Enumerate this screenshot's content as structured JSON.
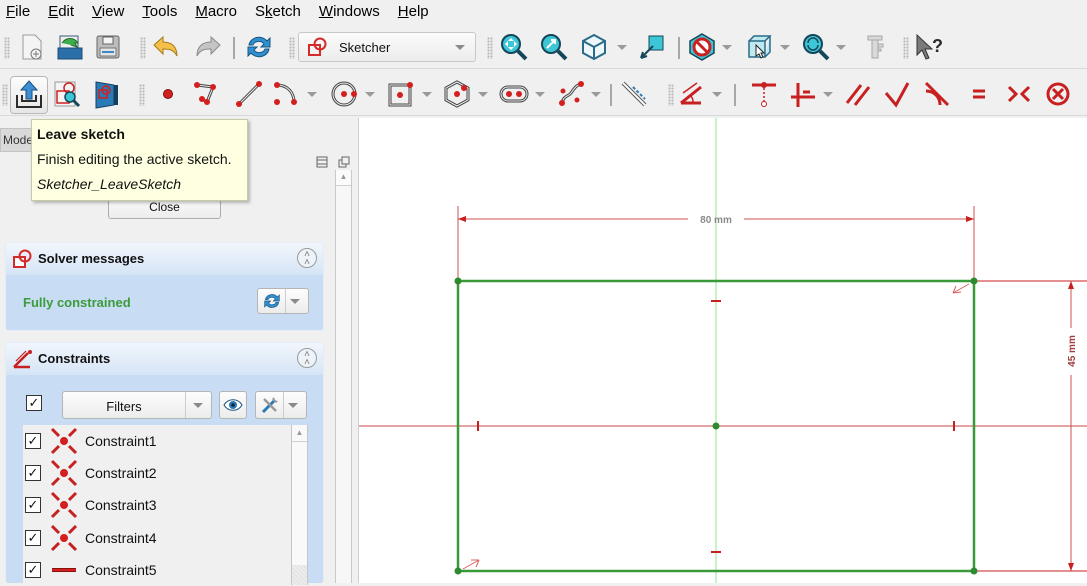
{
  "menu": [
    {
      "label": "File",
      "accel": "F"
    },
    {
      "label": "Edit",
      "accel": "E"
    },
    {
      "label": "View",
      "accel": "V"
    },
    {
      "label": "Tools",
      "accel": "T"
    },
    {
      "label": "Macro",
      "accel": "M"
    },
    {
      "label": "Sketch",
      "accel": "k"
    },
    {
      "label": "Windows",
      "accel": "W"
    },
    {
      "label": "Help",
      "accel": "H"
    }
  ],
  "toolbar": {
    "workbench_selector": {
      "selected": "Sketcher",
      "icon": "sketcher-workbench-icon"
    },
    "file_icons": [
      "new-document-icon",
      "open-document-icon",
      "save-icon"
    ],
    "edit_icons": [
      "undo-icon",
      "redo-icon",
      "refresh-icon"
    ],
    "view_icons": [
      "fit-all-icon",
      "fit-selection-icon",
      "isometric-view-icon",
      "view-section-icon",
      "draw-style-icon",
      "bounding-box-icon",
      "zoom-refresh-icon",
      "measure-icon",
      "whats-this-icon"
    ]
  },
  "sketcher_toolbar": {
    "leave_sketch": "leave-sketch-icon",
    "view_sketch": "view-sketch-icon",
    "view_section": "view-section-icon",
    "geometry": [
      "point-icon",
      "polyline-icon",
      "line-icon",
      "arc-icon",
      "circle-icon",
      "rectangle-icon",
      "polygon-icon",
      "slot-icon",
      "bspline-icon",
      "construction-mode-icon"
    ],
    "constraints": [
      "dimension-icon",
      "coincident-icon",
      "horizontal-vertical-icon",
      "parallel-icon",
      "perpendicular-icon",
      "tangent-icon",
      "equal-icon",
      "symmetric-icon",
      "block-icon"
    ]
  },
  "tooltip": {
    "title": "Leave sketch",
    "description": "Finish editing the active sketch.",
    "command": "Sketcher_LeaveSketch"
  },
  "panel": {
    "mode_tab": "Model",
    "close_label": "Close",
    "solver": {
      "title": "Solver messages",
      "status": "Fully constrained",
      "status_color": "#3a9c3a"
    },
    "constraints": {
      "title": "Constraints",
      "filters_label": "Filters",
      "select_all_checked": true,
      "items": [
        {
          "name": "Constraint1",
          "type": "coincident",
          "checked": true
        },
        {
          "name": "Constraint2",
          "type": "coincident",
          "checked": true
        },
        {
          "name": "Constraint3",
          "type": "coincident",
          "checked": true
        },
        {
          "name": "Constraint4",
          "type": "coincident",
          "checked": true
        },
        {
          "name": "Constraint5",
          "type": "horizontal",
          "checked": true
        }
      ]
    }
  },
  "sketch": {
    "width_dim": "80 mm",
    "height_dim": "45 mm",
    "geometry_color": "#3a9a3a",
    "constraint_color": "#c83232",
    "axis_h_color": "#c84646",
    "axis_v_color": "#8fe88f"
  }
}
